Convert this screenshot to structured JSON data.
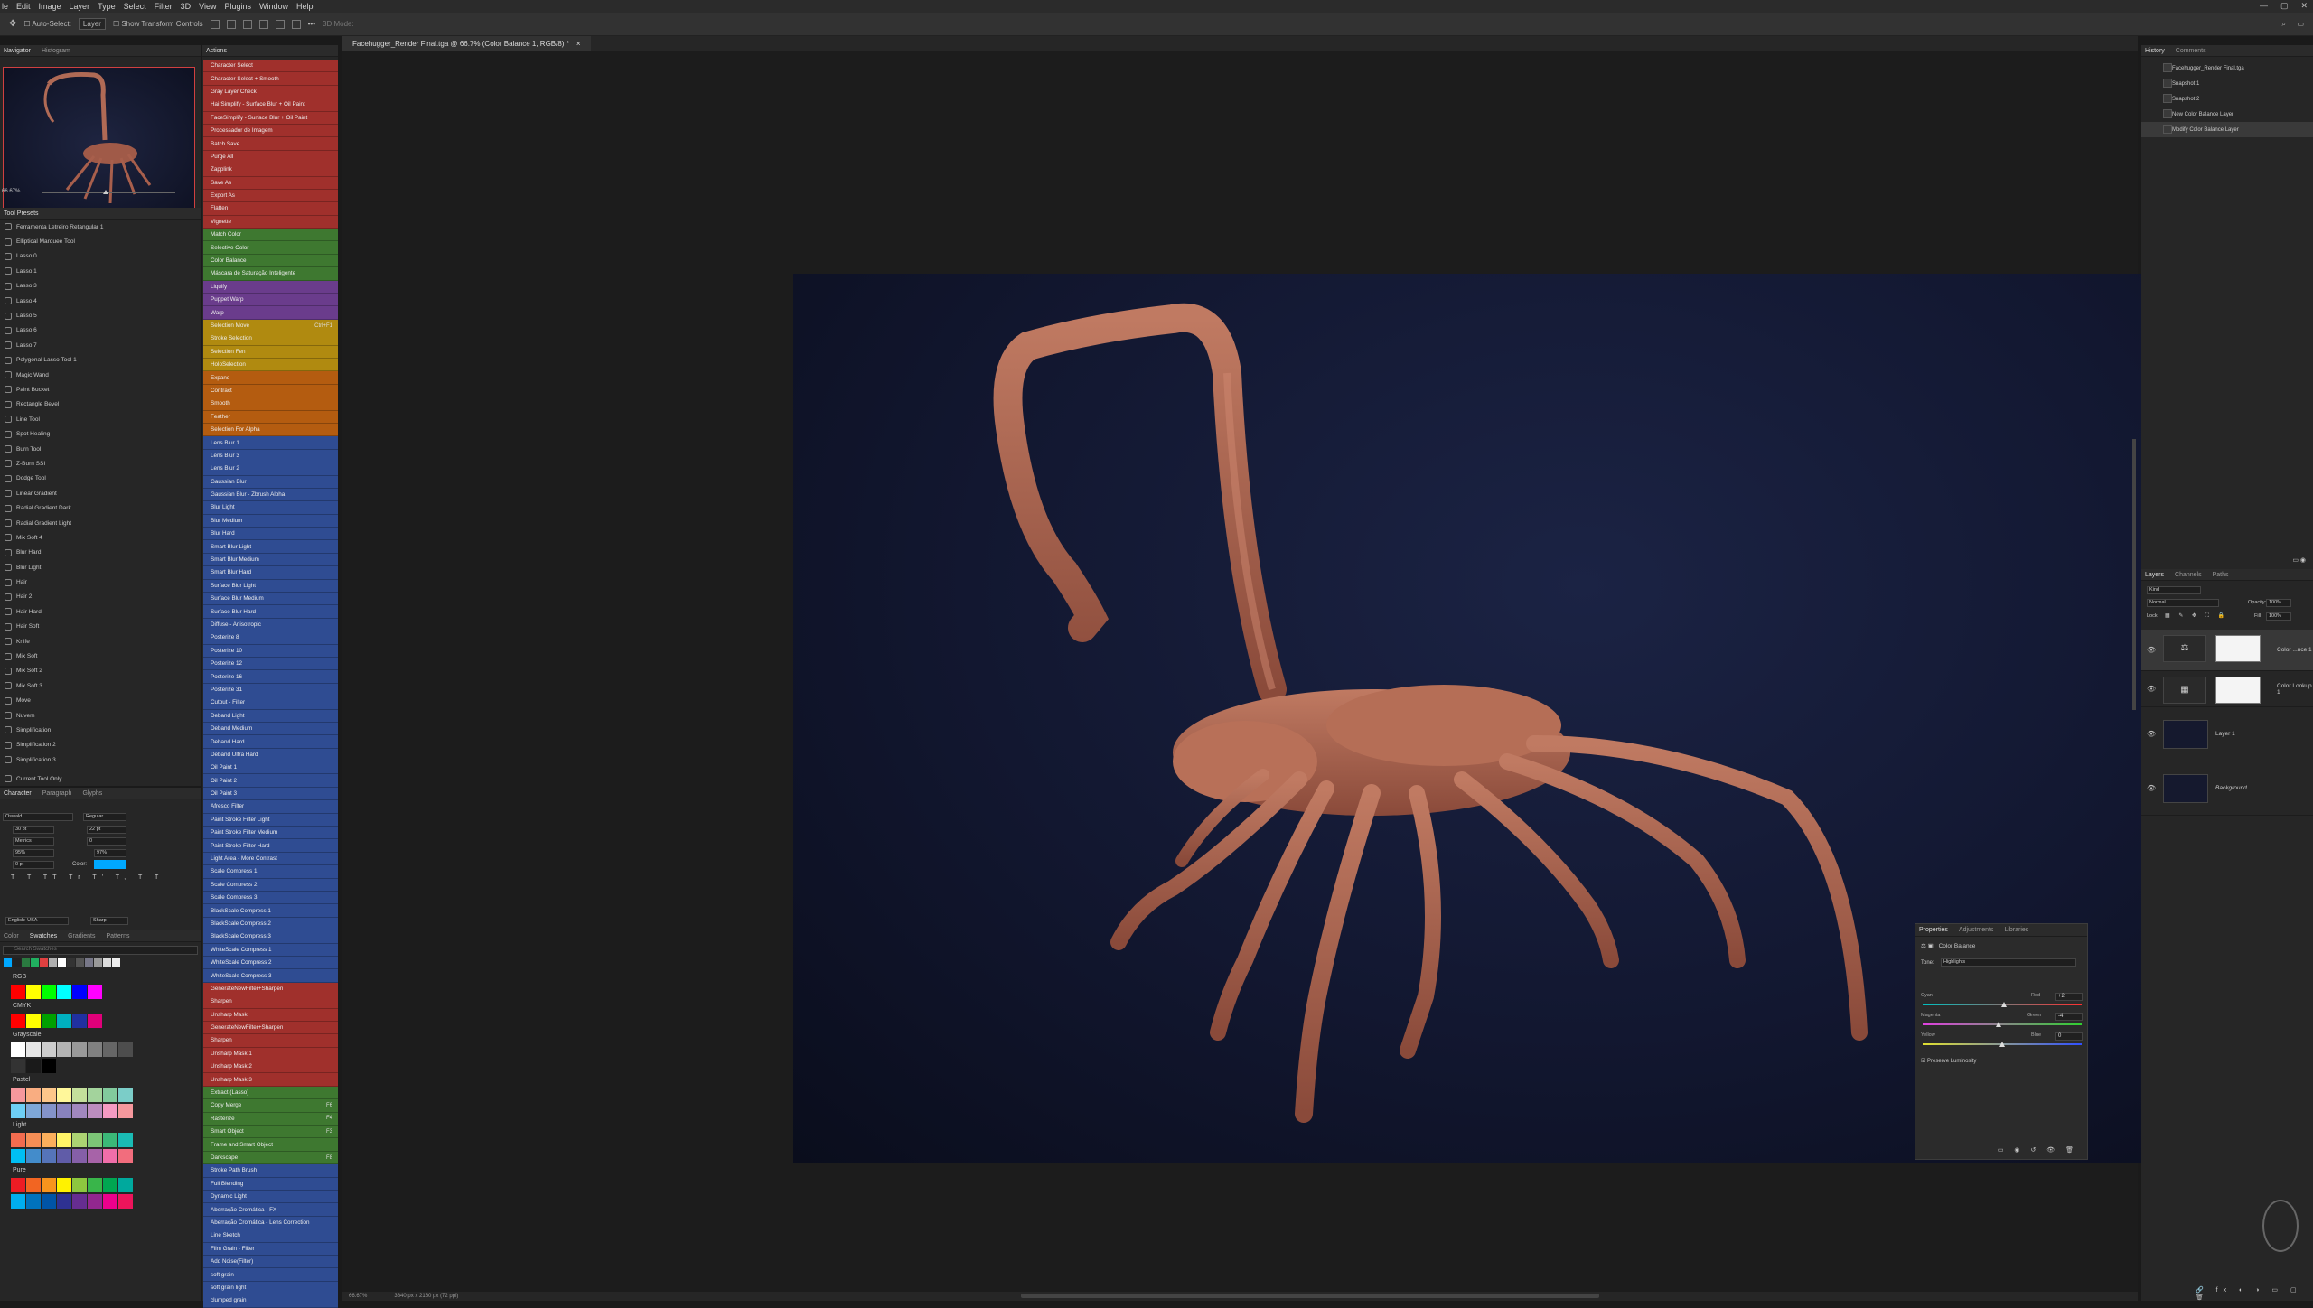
{
  "menu": [
    "le",
    "Edit",
    "Image",
    "Layer",
    "Type",
    "Select",
    "Filter",
    "3D",
    "View",
    "Plugins",
    "Window",
    "Help"
  ],
  "options": {
    "auto_select": "Auto-Select:",
    "layer": "Layer",
    "transform": "Show Transform Controls",
    "mode_3d": "3D Mode:"
  },
  "document_tab": "Facehugger_Render Final.tga @ 66.7% (Color Balance 1, RGB/8) *",
  "navigator": {
    "tabs": [
      "Navigator",
      "Histogram"
    ],
    "zoom": "66.67%"
  },
  "tool_presets": {
    "title": "Tool Presets",
    "items": [
      "Ferramenta Letreiro Retangular 1",
      "Elliptical Marquee Tool",
      "Lasso 0",
      "Lasso 1",
      "Lasso 3",
      "Lasso 4",
      "Lasso 5",
      "Lasso 6",
      "Lasso 7",
      "Polygonal Lasso Tool 1",
      "Magic Wand",
      "Paint Bucket",
      "Rectangle Bevel",
      "Line Tool",
      "Spot Healing",
      "Burn Tool",
      "Z-Burn SSI",
      "Dodge Tool",
      "Linear Gradient",
      "Radial Gradient Dark",
      "Radial Gradient Light",
      "Mix Soft 4",
      "Blur Hard",
      "Blur Light",
      "Hair",
      "Hair 2",
      "Hair Hard",
      "Hair Soft",
      "Knife",
      "Mix Soft",
      "Mix Soft 2",
      "Mix Soft 3",
      "Move",
      "Nuvem",
      "Simplification",
      "Simplification 2",
      "Simplification 3"
    ],
    "current_only": "Current Tool Only"
  },
  "actions": {
    "title": "Actions",
    "items": [
      {
        "label": "Character Select",
        "c": "red"
      },
      {
        "label": "Character Select + Smooth",
        "c": "red"
      },
      {
        "label": "Gray Layer Check",
        "c": "red"
      },
      {
        "label": "HairSimplify - Surface Blur + Oil Paint",
        "c": "red"
      },
      {
        "label": "FaceSimplify - Surface Blur + Oil Paint",
        "c": "red"
      },
      {
        "label": "Processador de Imagem",
        "c": "red"
      },
      {
        "label": "Batch Save",
        "c": "red"
      },
      {
        "label": "Purge All",
        "c": "red"
      },
      {
        "label": "Zapplink",
        "c": "red"
      },
      {
        "label": "Save As",
        "c": "red"
      },
      {
        "label": "Export As",
        "c": "red"
      },
      {
        "label": "Flatten",
        "c": "red"
      },
      {
        "label": "Vignette",
        "c": "red"
      },
      {
        "label": "Match Color",
        "c": "green"
      },
      {
        "label": "Selective Color",
        "c": "green"
      },
      {
        "label": "Color Balance",
        "c": "green"
      },
      {
        "label": "Máscara de Saturação Inteligente",
        "c": "green"
      },
      {
        "label": "Liquify",
        "c": "purple"
      },
      {
        "label": "Puppet Warp",
        "c": "purple"
      },
      {
        "label": "Warp",
        "c": "purple"
      },
      {
        "label": "Selection Move",
        "c": "yellow",
        "k": "Ctrl+F1"
      },
      {
        "label": "Stroke Selection",
        "c": "yellow"
      },
      {
        "label": "Selection Fen",
        "c": "yellow"
      },
      {
        "label": "HoloSelection",
        "c": "yellow"
      },
      {
        "label": "Expand",
        "c": "orange"
      },
      {
        "label": "Contract",
        "c": "orange"
      },
      {
        "label": "Smooth",
        "c": "orange"
      },
      {
        "label": "Feather",
        "c": "orange"
      },
      {
        "label": "Selection For Alpha",
        "c": "orange"
      },
      {
        "label": "Lens Blur 1",
        "c": "blue"
      },
      {
        "label": "Lens Blur 3",
        "c": "blue"
      },
      {
        "label": "Lens Blur 2",
        "c": "blue"
      },
      {
        "label": "Gaussian Blur",
        "c": "blue"
      },
      {
        "label": "Gaussian Blur - Zbrush Alpha",
        "c": "blue"
      },
      {
        "label": "Blur Light",
        "c": "blue"
      },
      {
        "label": "Blur Medium",
        "c": "blue"
      },
      {
        "label": "Blur Hard",
        "c": "blue"
      },
      {
        "label": "Smart Blur Light",
        "c": "blue"
      },
      {
        "label": "Smart Blur Medium",
        "c": "blue"
      },
      {
        "label": "Smart Blur Hard",
        "c": "blue"
      },
      {
        "label": "Surface Blur Light",
        "c": "blue"
      },
      {
        "label": "Surface Blur Medium",
        "c": "blue"
      },
      {
        "label": "Surface Blur Hard",
        "c": "blue"
      },
      {
        "label": "Diffuse - Anisotropic",
        "c": "blue"
      },
      {
        "label": "Posterize 8",
        "c": "blue"
      },
      {
        "label": "Posterize 10",
        "c": "blue"
      },
      {
        "label": "Posterize 12",
        "c": "blue"
      },
      {
        "label": "Posterize 16",
        "c": "blue"
      },
      {
        "label": "Posterize 31",
        "c": "blue"
      },
      {
        "label": "Cutout - Filter",
        "c": "blue"
      },
      {
        "label": "Deband Light",
        "c": "blue"
      },
      {
        "label": "Deband Medium",
        "c": "blue"
      },
      {
        "label": "Deband Hard",
        "c": "blue"
      },
      {
        "label": "Deband Ultra Hard",
        "c": "blue"
      },
      {
        "label": "Oil Paint 1",
        "c": "blue"
      },
      {
        "label": "Oil Paint 2",
        "c": "blue"
      },
      {
        "label": "Oil Paint 3",
        "c": "blue"
      },
      {
        "label": "Afresco Filter",
        "c": "blue"
      },
      {
        "label": "Paint Stroke Filter Light",
        "c": "blue"
      },
      {
        "label": "Paint Stroke Filter Medium",
        "c": "blue"
      },
      {
        "label": "Paint Stroke Filter Hard",
        "c": "blue"
      },
      {
        "label": "Light Area - More Contrast",
        "c": "blue"
      },
      {
        "label": "Scale Compress 1",
        "c": "blue"
      },
      {
        "label": "Scale Compress 2",
        "c": "blue"
      },
      {
        "label": "Scale Compress 3",
        "c": "blue"
      },
      {
        "label": "BlackScale Compress 1",
        "c": "blue"
      },
      {
        "label": "BlackScale Compress 2",
        "c": "blue"
      },
      {
        "label": "BlackScale Compress 3",
        "c": "blue"
      },
      {
        "label": "WhiteScale Compress 1",
        "c": "blue"
      },
      {
        "label": "WhiteScale Compress 2",
        "c": "blue"
      },
      {
        "label": "WhiteScale Compress 3",
        "c": "blue"
      },
      {
        "label": "GenerateNewFilter+Sharpen",
        "c": "red"
      },
      {
        "label": "Sharpen",
        "c": "red"
      },
      {
        "label": "Unsharp Mask",
        "c": "red"
      },
      {
        "label": "GenerateNewFilter+Sharpen",
        "c": "red"
      },
      {
        "label": "Sharpen",
        "c": "red"
      },
      {
        "label": "Unsharp Mask 1",
        "c": "red"
      },
      {
        "label": "Unsharp Mask 2",
        "c": "red"
      },
      {
        "label": "Unsharp Mask 3",
        "c": "red"
      },
      {
        "label": "Extract (Lasso)",
        "c": "green"
      },
      {
        "label": "Copy Merge",
        "c": "green",
        "k": "F6"
      },
      {
        "label": "Rasterize",
        "c": "green",
        "k": "F4"
      },
      {
        "label": "Smart Object",
        "c": "green",
        "k": "F3"
      },
      {
        "label": "Frame and Smart Object",
        "c": "green"
      },
      {
        "label": "Darkscape",
        "c": "green",
        "k": "F8"
      },
      {
        "label": "Stroke Path Brush",
        "c": "blue"
      },
      {
        "label": "Full Blending",
        "c": "blue"
      },
      {
        "label": "Dynamic Light",
        "c": "blue"
      },
      {
        "label": "Aberração Cromática - FX",
        "c": "blue"
      },
      {
        "label": "Aberração Cromática - Lens Correction",
        "c": "blue"
      },
      {
        "label": "Line Sketch",
        "c": "blue"
      },
      {
        "label": "Film Grain - Filter",
        "c": "blue"
      },
      {
        "label": "Add Noise(Filter)",
        "c": "blue"
      },
      {
        "label": "soft grain",
        "c": "blue"
      },
      {
        "label": "soft grain light",
        "c": "blue"
      },
      {
        "label": "clumped grain",
        "c": "blue"
      }
    ]
  },
  "character": {
    "tabs": [
      "Character",
      "Paragraph",
      "Glyphs"
    ],
    "font": "Oswald",
    "style": "Regular",
    "size": "30 pt",
    "leading": "22 pt",
    "kerning": "Metrics",
    "tracking": "0",
    "vscale": "95%",
    "hscale": "97%",
    "baseline": "0 pt",
    "color_label": "Color:",
    "lang": "English: USA",
    "aa": "Sharp"
  },
  "swatches": {
    "tabs": [
      "Color",
      "Swatches",
      "Gradients",
      "Patterns"
    ],
    "search": "Search Swatches",
    "groups": [
      "RGB",
      "CMYK",
      "Grayscale",
      "Pastel",
      "Light",
      "Pure"
    ]
  },
  "status": {
    "zoom": "66.67%",
    "size": "3840 px x 2160 px (72 ppi)"
  },
  "history": {
    "tabs": [
      "History",
      "Comments"
    ],
    "items": [
      "Facehugger_Render Final.tga",
      "Snapshot 1",
      "Snapshot 2",
      "New Color Balance Layer",
      "Modify Color Balance Layer"
    ]
  },
  "layers": {
    "tabs": [
      "Layers",
      "Channels",
      "Paths"
    ],
    "kind": "Kind",
    "blend": "Normal",
    "opacity_label": "Opacity:",
    "opacity": "100%",
    "lock_label": "Lock:",
    "fill_label": "Fill:",
    "fill": "100%",
    "items": [
      "Color ...nce 1",
      "Color Lookup 1",
      "Layer 1",
      "Background"
    ]
  },
  "properties": {
    "tabs": [
      "Properties",
      "Adjustments",
      "Libraries"
    ],
    "title": "Color Balance",
    "tone_label": "Tone:",
    "tone": "Highlights",
    "cyan": "Cyan",
    "red": "Red",
    "cyan_val": "+2",
    "magenta": "Magenta",
    "green": "Green",
    "magenta_val": "-4",
    "yellow": "Yellow",
    "blue": "Blue",
    "yellow_val": "0",
    "preserve": "Preserve Luminosity",
    "cyan_pos": 0.51,
    "magenta_pos": 0.48,
    "yellow_pos": 0.5
  }
}
